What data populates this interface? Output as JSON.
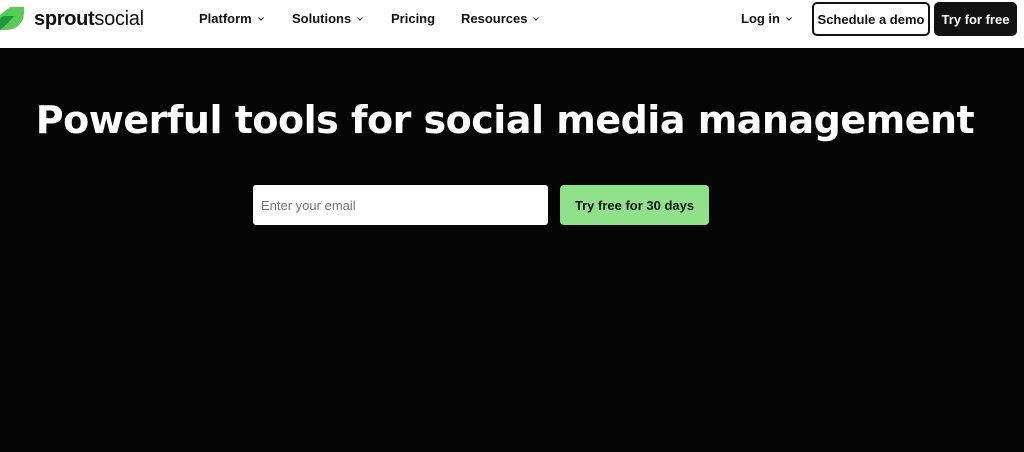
{
  "brand": {
    "name_bold": "sprout",
    "name_regular": "social",
    "accent_color": "#59cb59",
    "accent_dark": "#1f9a3f"
  },
  "nav": {
    "items": [
      {
        "label": "Platform",
        "has_dropdown": true
      },
      {
        "label": "Solutions",
        "has_dropdown": true
      },
      {
        "label": "Pricing",
        "has_dropdown": false
      },
      {
        "label": "Resources",
        "has_dropdown": true
      }
    ],
    "login": {
      "label": "Log in",
      "has_dropdown": true
    },
    "demo_button": "Schedule a demo",
    "try_button": "Try for free"
  },
  "hero": {
    "title": "Powerful tools for social media management",
    "email_placeholder": "Enter your email",
    "email_value": "",
    "cta_label": "Try free for 30 days",
    "background": "#050505",
    "cta_color": "#8fe28a"
  },
  "icons": {
    "logo": "sprout-leaf-icon",
    "dropdown": "chevron-down-icon"
  }
}
